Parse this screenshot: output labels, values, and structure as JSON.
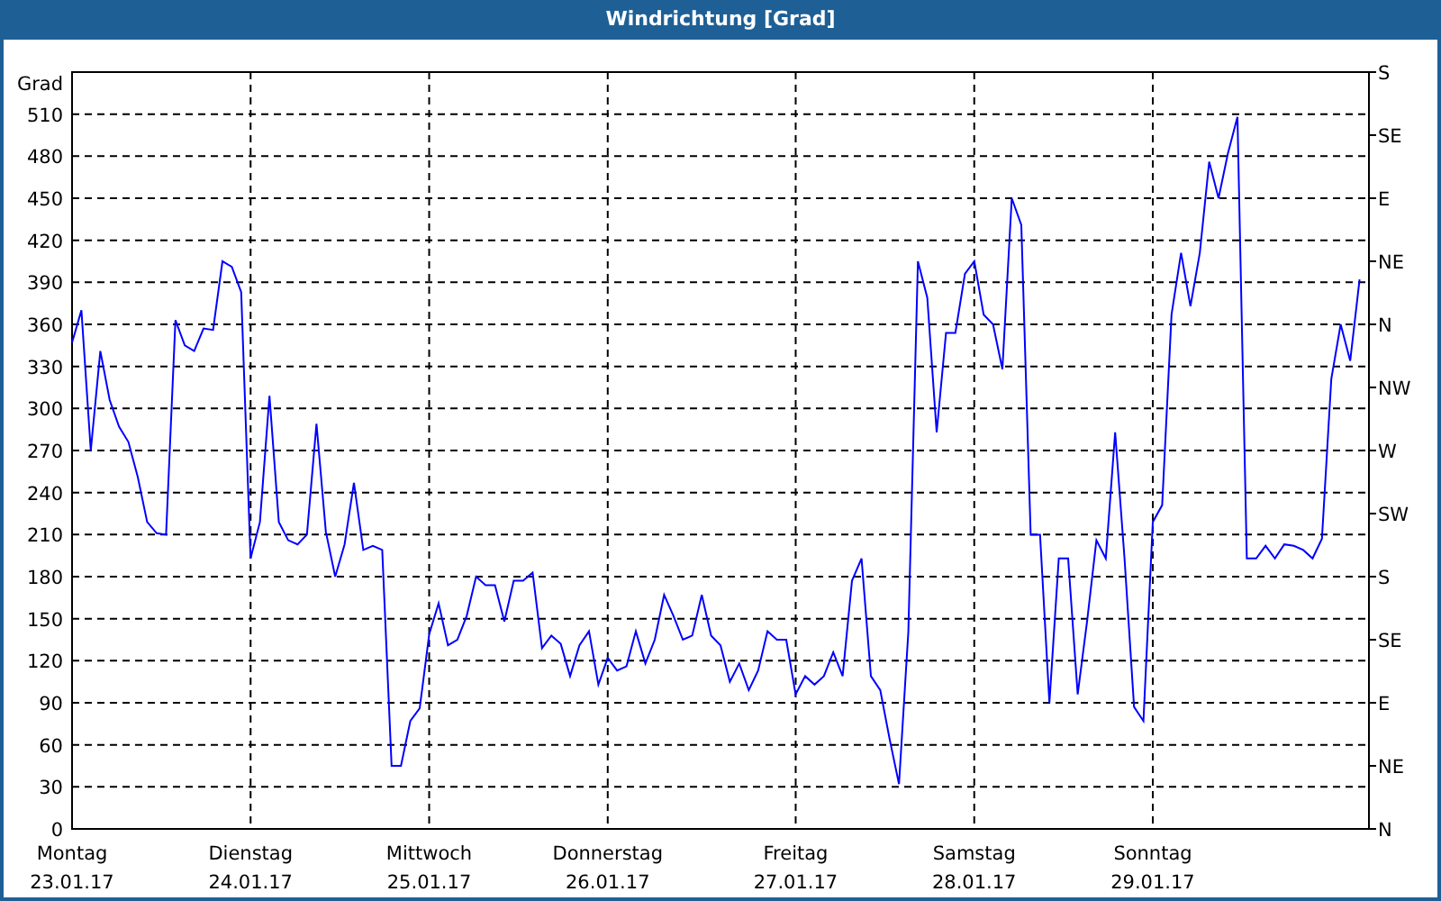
{
  "window": {
    "title": "Windrichtung [Grad]"
  },
  "chart": {
    "compass_ticks": [
      "S",
      "SE",
      "E",
      "NE",
      "N",
      "NW",
      "W",
      "SW",
      "S",
      "SE",
      "E",
      "NE",
      "N"
    ],
    "chart_data": {
      "type": "line",
      "ylabel": "Grad",
      "grid": true,
      "ylim": [
        0,
        540
      ],
      "categories": [
        "Montag\n23.01.17",
        null,
        null,
        null,
        null,
        null,
        null,
        null,
        null,
        null,
        null,
        null,
        null,
        null,
        null,
        null,
        null,
        null,
        null,
        "Dienstag\n24.01.17",
        null,
        null,
        null,
        null,
        null,
        null,
        null,
        null,
        null,
        null,
        null,
        null,
        null,
        null,
        null,
        null,
        null,
        null,
        "Mittwoch\n25.01.17",
        null,
        null,
        null,
        null,
        null,
        null,
        null,
        null,
        null,
        null,
        null,
        null,
        null,
        null,
        null,
        null,
        null,
        null,
        "Donnerstag\n26.01.17",
        null,
        null,
        null,
        null,
        null,
        null,
        null,
        null,
        null,
        null,
        null,
        null,
        null,
        null,
        null,
        null,
        null,
        null,
        null,
        "Freitag\n27.01.17",
        null,
        null,
        null,
        null,
        null,
        null,
        null,
        null,
        null,
        null,
        null,
        null,
        null,
        null,
        null,
        null,
        null,
        null,
        "Samstag\n28.01.17",
        null,
        null,
        null,
        null,
        null,
        null,
        null,
        null,
        null,
        null,
        null,
        null,
        null,
        null,
        null,
        null,
        null,
        null,
        "Sonntag\n29.01.17",
        null,
        null,
        null,
        null,
        null,
        null,
        null,
        null,
        null,
        null,
        null,
        null,
        null,
        null,
        null,
        null,
        null,
        null,
        null,
        null,
        null,
        null
      ],
      "yticks": [
        0,
        30,
        60,
        90,
        120,
        150,
        180,
        210,
        240,
        270,
        300,
        330,
        360,
        390,
        420,
        450,
        480,
        510
      ],
      "series": [
        {
          "color": "#0000ff",
          "values": [
            347,
            370,
            270,
            341,
            306,
            287,
            276,
            251,
            219,
            211,
            210,
            363,
            345,
            341,
            357,
            356,
            405,
            401,
            383,
            193,
            219,
            309,
            219,
            206,
            203,
            210,
            289,
            212,
            180,
            203,
            247,
            199,
            202,
            199,
            45,
            45,
            77,
            86,
            139,
            161,
            131,
            135,
            152,
            180,
            174,
            174,
            148,
            177,
            177,
            183,
            129,
            138,
            132,
            109,
            131,
            141,
            103,
            122,
            113,
            116,
            141,
            118,
            135,
            167,
            152,
            135,
            138,
            167,
            138,
            131,
            105,
            118,
            99,
            113,
            141,
            135,
            135,
            96,
            109,
            103,
            109,
            126,
            109,
            177,
            193,
            109,
            99,
            64,
            32,
            141,
            405,
            379,
            283,
            354,
            354,
            396,
            405,
            367,
            360,
            328,
            450,
            431,
            210,
            210,
            90,
            193,
            193,
            96,
            148,
            206,
            193,
            283,
            193,
            87,
            77,
            219,
            231,
            367,
            411,
            373,
            411,
            476,
            450,
            482,
            508,
            193,
            193,
            202,
            193,
            203,
            202,
            199,
            193,
            207,
            321,
            360,
            334,
            392
          ]
        }
      ]
    }
  }
}
